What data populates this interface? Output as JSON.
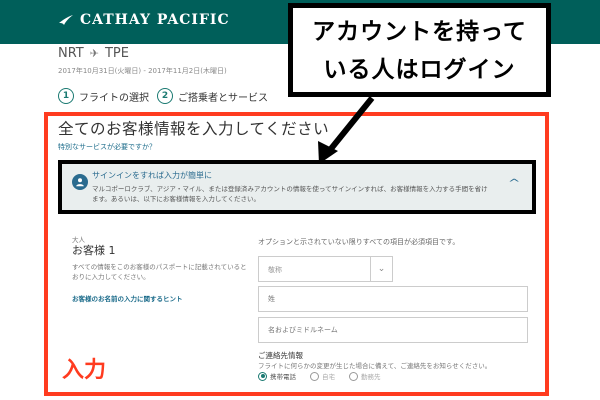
{
  "header": {
    "logo_text": "CATHAY PACIFIC",
    "bg_color": "#005f5a"
  },
  "route": {
    "origin": "NRT",
    "destination": "TPE",
    "dates": "2017年10月31日(火曜日) - 2017年11月2日(木曜日)"
  },
  "steps": [
    {
      "num": "1",
      "label": "フライトの選択"
    },
    {
      "num": "2",
      "label": "ご搭乗者とサービス"
    }
  ],
  "main": {
    "title": "全てのお客様情報を入力してください",
    "special_link": "特別なサービスが必要ですか？"
  },
  "signin": {
    "title": "サインインをすれば入力が簡単に",
    "desc": "マルコポーロクラブ、アジア・マイル、または登録済みアカウントの情報を使ってサインインすれば、お客様情報を入力する手間を省けます。あるいは、以下にお客様情報を入力してください。"
  },
  "passenger": {
    "type": "大人",
    "title": "お客様 1",
    "desc": "すべての情報をこのお客様のパスポートに記載されているとおりに入力してください。",
    "hint": "お客様のお名前の入力に関するヒント"
  },
  "form": {
    "required_note": "オプションと示されていない限りすべての項目が必須項目です。",
    "salutation": "敬称",
    "lastname_placeholder": "姓",
    "firstname_placeholder": "名およびミドルネーム",
    "contact_title": "ご連絡先情報",
    "contact_desc": "フライトに何らかの変更が生じた場合に備えて、ご連絡先をお知らせください。",
    "phone_options": [
      "携帯電話",
      "自宅",
      "勤務先"
    ]
  },
  "annotations": {
    "callout_line1": "アカウントを持って",
    "callout_line2": "いる人はログイン",
    "input_label": "入力",
    "accent_color": "#ff3b1f"
  }
}
